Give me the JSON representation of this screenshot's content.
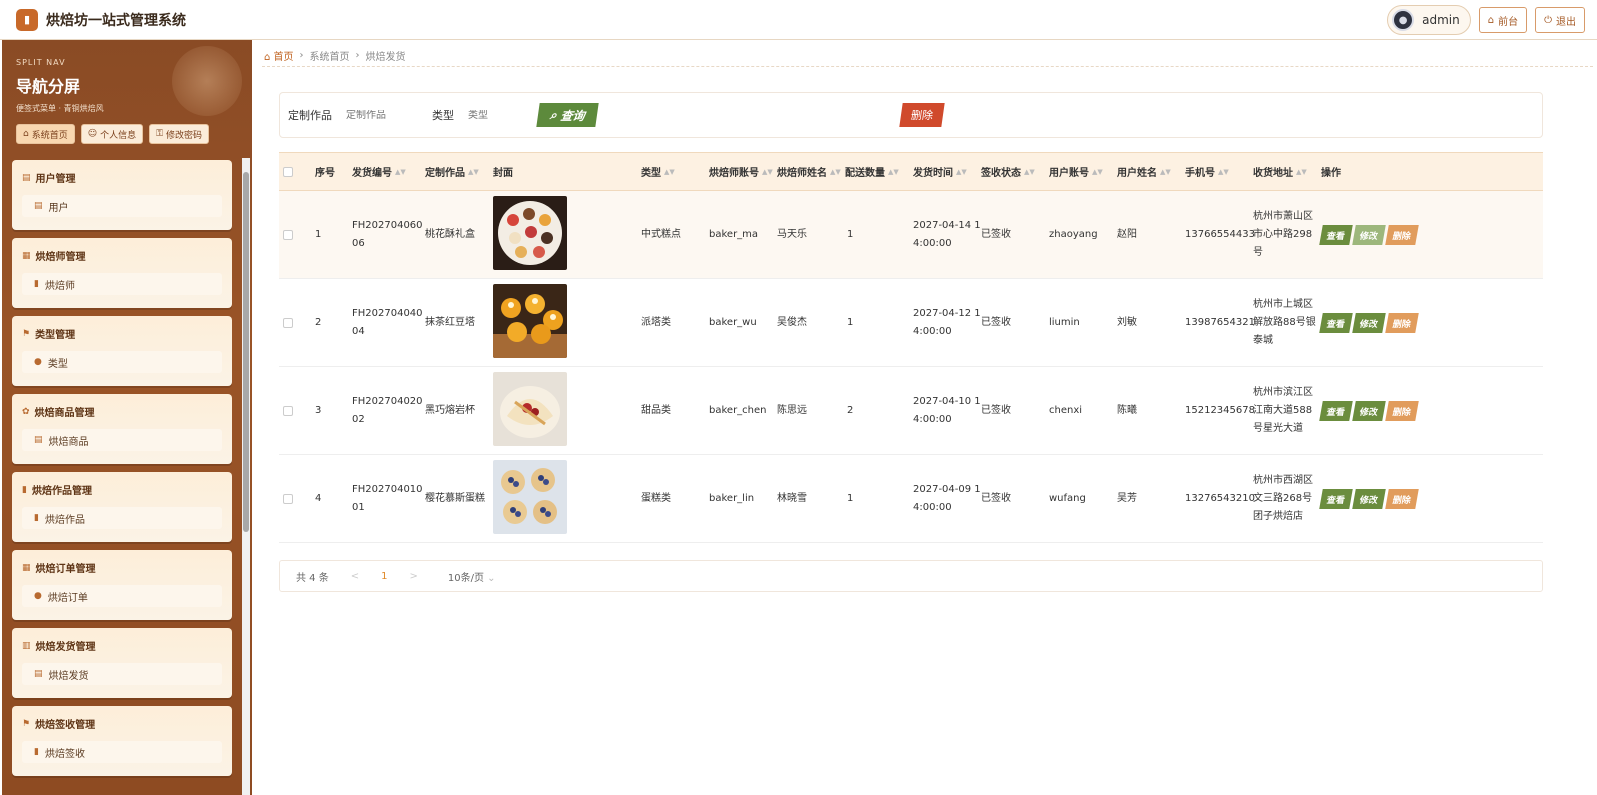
{
  "app": {
    "title": "烘焙坊一站式管理系统"
  },
  "topbar": {
    "user": "admin",
    "front_label": "前台",
    "logout_label": "退出"
  },
  "sidebar": {
    "subtitle": "SPLIT NAV",
    "title": "导航分屏",
    "desc": "便签式菜单 · 青铜烘焙风",
    "links": [
      {
        "label": "系统首页"
      },
      {
        "label": "个人信息"
      },
      {
        "label": "修改密码"
      }
    ],
    "groups": [
      {
        "title": "用户管理",
        "item": "用户"
      },
      {
        "title": "烘焙师管理",
        "item": "烘焙师"
      },
      {
        "title": "类型管理",
        "item": "类型"
      },
      {
        "title": "烘焙商品管理",
        "item": "烘焙商品"
      },
      {
        "title": "烘焙作品管理",
        "item": "烘焙作品"
      },
      {
        "title": "烘焙订单管理",
        "item": "烘焙订单"
      },
      {
        "title": "烘焙发货管理",
        "item": "烘焙发货"
      },
      {
        "title": "烘焙签收管理",
        "item": "烘焙签收"
      }
    ]
  },
  "breadcrumb": {
    "home": "首页",
    "level1": "系统首页",
    "level2": "烘焙发货"
  },
  "search": {
    "field1_label": "定制作品",
    "field1_placeholder": "定制作品",
    "field2_label": "类型",
    "field2_placeholder": "类型",
    "query_label": "查询",
    "delete_label": "删除"
  },
  "table": {
    "headers": {
      "seq": "序号",
      "code": "发货编号",
      "work": "定制作品",
      "cover": "封面",
      "type": "类型",
      "baker_account": "烘焙师账号",
      "baker_name": "烘焙师姓名",
      "qty": "配送数量",
      "time": "发货时间",
      "status": "签收状态",
      "user_account": "用户账号",
      "user_name": "用户姓名",
      "phone": "手机号",
      "address": "收货地址",
      "ops": "操作"
    },
    "rows": [
      {
        "seq": "1",
        "code": "FH20270406006",
        "work": "桃花酥礼盒",
        "type": "中式糕点",
        "baker_account": "baker_ma",
        "baker_name": "马天乐",
        "qty": "1",
        "time": "2027-04-14 14:00:00",
        "status": "已签收",
        "user_account": "zhaoyang",
        "user_name": "赵阳",
        "phone": "13766554433",
        "address": "杭州市萧山区市心中路298号"
      },
      {
        "seq": "2",
        "code": "FH20270404004",
        "work": "抹茶红豆塔",
        "type": "派塔类",
        "baker_account": "baker_wu",
        "baker_name": "吴俊杰",
        "qty": "1",
        "time": "2027-04-12 14:00:00",
        "status": "已签收",
        "user_account": "liumin",
        "user_name": "刘敏",
        "phone": "13987654321",
        "address": "杭州市上城区解放路88号银泰城"
      },
      {
        "seq": "3",
        "code": "FH20270402002",
        "work": "黑巧熔岩杯",
        "type": "甜品类",
        "baker_account": "baker_chen",
        "baker_name": "陈思远",
        "qty": "2",
        "time": "2027-04-10 14:00:00",
        "status": "已签收",
        "user_account": "chenxi",
        "user_name": "陈曦",
        "phone": "15212345678",
        "address": "杭州市滨江区江南大道588号星光大道"
      },
      {
        "seq": "4",
        "code": "FH20270401001",
        "work": "樱花慕斯蛋糕",
        "type": "蛋糕类",
        "baker_account": "baker_lin",
        "baker_name": "林晓雪",
        "qty": "1",
        "time": "2027-04-09 14:00:00",
        "status": "已签收",
        "user_account": "wufang",
        "user_name": "吴芳",
        "phone": "13276543210",
        "address": "杭州市西湖区文三路268号团子烘焙店"
      }
    ],
    "ops": {
      "view": "查看",
      "edit": "修改",
      "del": "删除"
    }
  },
  "pager": {
    "total": "共 4 条",
    "prev": "<",
    "page": "1",
    "next": ">",
    "size": "10条/页"
  },
  "colors": {
    "accent": "#c0621f",
    "sidebar": "#8a4b25",
    "green": "#6b8d3e",
    "orange": "#e19c5c",
    "red": "#d04a2c"
  }
}
